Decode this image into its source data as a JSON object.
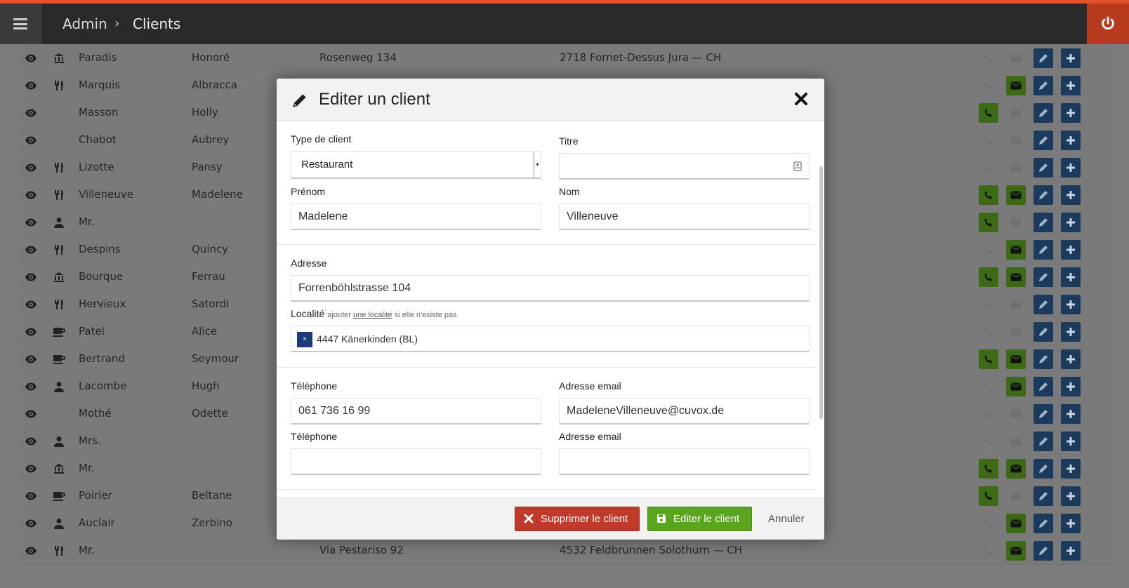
{
  "header": {
    "breadcrumb_admin": "Admin",
    "breadcrumb_sep": "›",
    "breadcrumb_current": "Clients",
    "accent": "#e2532b"
  },
  "clients": [
    {
      "type_icon": "bank-icon",
      "nom": "Paradis",
      "prenom": "Honoré",
      "adresse": "Rosenweg 134",
      "localite": "2718 Fornet-Dessus   Jura — CH",
      "phone": false,
      "mail": false
    },
    {
      "type_icon": "fork-knife-icon",
      "nom": "Marquis",
      "prenom": "Albracca",
      "adresse": "",
      "localite": "",
      "phone": false,
      "mail": true
    },
    {
      "type_icon": "",
      "nom": "Masson",
      "prenom": "Holly",
      "adresse": "",
      "localite": "",
      "phone": true,
      "mail": false
    },
    {
      "type_icon": "",
      "nom": "Chabot",
      "prenom": "Aubrey",
      "adresse": "",
      "localite": "",
      "phone": false,
      "mail": false
    },
    {
      "type_icon": "fork-knife-icon",
      "nom": "Lizotte",
      "prenom": "Pansy",
      "adresse": "",
      "localite": "",
      "phone": false,
      "mail": false
    },
    {
      "type_icon": "fork-knife-icon",
      "nom": "Villeneuve",
      "prenom": "Madelene",
      "adresse": "",
      "localite": "",
      "phone": true,
      "mail": true
    },
    {
      "type_icon": "person-icon",
      "nom": "Mr.",
      "prenom": "",
      "adresse": "",
      "localite": "",
      "phone": true,
      "mail": false
    },
    {
      "type_icon": "fork-knife-icon",
      "nom": "Despins",
      "prenom": "Quincy",
      "adresse": "",
      "localite": "",
      "phone": false,
      "mail": true
    },
    {
      "type_icon": "bank-icon",
      "nom": "Bourque",
      "prenom": "Ferrau",
      "adresse": "",
      "localite": "",
      "phone": true,
      "mail": true
    },
    {
      "type_icon": "fork-knife-icon",
      "nom": "Hervieux",
      "prenom": "Satordi",
      "adresse": "",
      "localite": "",
      "phone": false,
      "mail": false
    },
    {
      "type_icon": "coffee-icon",
      "nom": "Patel",
      "prenom": "Alice",
      "adresse": "",
      "localite": "",
      "phone": false,
      "mail": false
    },
    {
      "type_icon": "coffee-icon",
      "nom": "Bertrand",
      "prenom": "Seymour",
      "adresse": "",
      "localite": "",
      "phone": true,
      "mail": true
    },
    {
      "type_icon": "person-icon",
      "nom": "Lacombe",
      "prenom": "Hugh",
      "adresse": "",
      "localite": "",
      "phone": false,
      "mail": true
    },
    {
      "type_icon": "",
      "nom": "Mothé",
      "prenom": "Odette",
      "adresse": "",
      "localite": "",
      "phone": false,
      "mail": false
    },
    {
      "type_icon": "person-icon",
      "nom": "Mrs.",
      "prenom": "",
      "adresse": "",
      "localite": "",
      "phone": false,
      "mail": false
    },
    {
      "type_icon": "bank-icon",
      "nom": "Mr.",
      "prenom": "",
      "adresse": "",
      "localite": "",
      "phone": true,
      "mail": true
    },
    {
      "type_icon": "coffee-icon",
      "nom": "Poirier",
      "prenom": "Beltane",
      "adresse": "",
      "localite": "",
      "phone": true,
      "mail": false
    },
    {
      "type_icon": "person-icon",
      "nom": "Auclair",
      "prenom": "Zerbino",
      "adresse": "",
      "localite": "",
      "phone": false,
      "mail": true
    },
    {
      "type_icon": "fork-knife-icon",
      "nom": "Mr.",
      "prenom": "",
      "adresse": "Via Pestariso 92",
      "localite": "4532 Feldbrunnen   Solothurn — CH",
      "phone": false,
      "mail": true
    }
  ],
  "modal": {
    "title": "Editer un client",
    "type_label": "Type de client",
    "type_value": "Restaurant",
    "titre_label": "Titre",
    "titre_value": "",
    "prenom_label": "Prénom",
    "prenom_value": "Madelene",
    "nom_label": "Nom",
    "nom_value": "Villeneuve",
    "adresse_label": "Adresse",
    "adresse_value": "Forrenböhlstrasse 104",
    "localite_label": "Localité",
    "localite_hint_pre": "ajouter",
    "localite_hint_link": "une localité",
    "localite_hint_post": "si elle n'existe pas",
    "localite_tag_x": "×",
    "localite_value": "4447 Känerkinden (BL)",
    "tel1_label": "Téléphone",
    "tel1_value": "061 736 16 99",
    "email1_label": "Adresse email",
    "email1_value": "MadeleneVilleneuve@cuvox.de",
    "tel2_label": "Téléphone",
    "tel2_value": "",
    "email2_label": "Adresse email",
    "email2_value": "",
    "delete_label": "Supprimer le client",
    "edit_label": "Editer le client",
    "cancel_label": "Annuler"
  },
  "colors": {
    "danger": "#c0392b",
    "success": "#5aa51e",
    "action_blue": "#1c3b5c",
    "contact_green": "#3d6a14"
  }
}
